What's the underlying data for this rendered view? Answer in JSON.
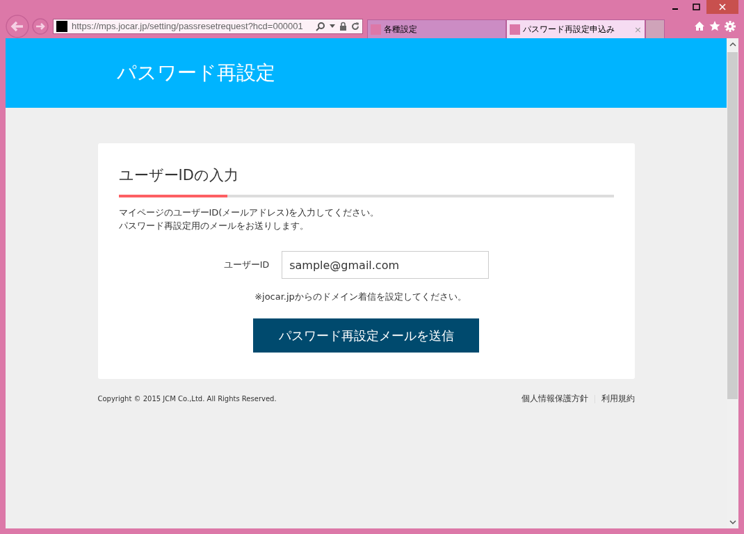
{
  "browser": {
    "url": "https://mps.jocar.jp/setting/passresetrequest?hcd=000001",
    "tabs": [
      {
        "label": "各種設定",
        "selected": false
      },
      {
        "label": "パスワード再設定申込み",
        "selected": true,
        "close_glyph": "×"
      }
    ]
  },
  "header": {
    "title": "パスワード再設定"
  },
  "card": {
    "heading": "ユーザーIDの入力",
    "step_progress": {
      "level": 0.22
    },
    "description": [
      "マイページのユーザーID(メールアドレス)を入力してください。",
      "パスワード再設定用のメールをお送りします。"
    ],
    "field": {
      "label": "ユーザーID",
      "value": "sample@gmail.com"
    },
    "note": "※jocar.jpからのドメイン着信を設定してください。",
    "button": "パスワード再設定メールを送信"
  },
  "footer": {
    "copyright": "Copyright © 2015 JCM Co.,Ltd. All Rights Reserved.",
    "links": [
      "個人情報保護方針",
      "利用規約"
    ]
  }
}
